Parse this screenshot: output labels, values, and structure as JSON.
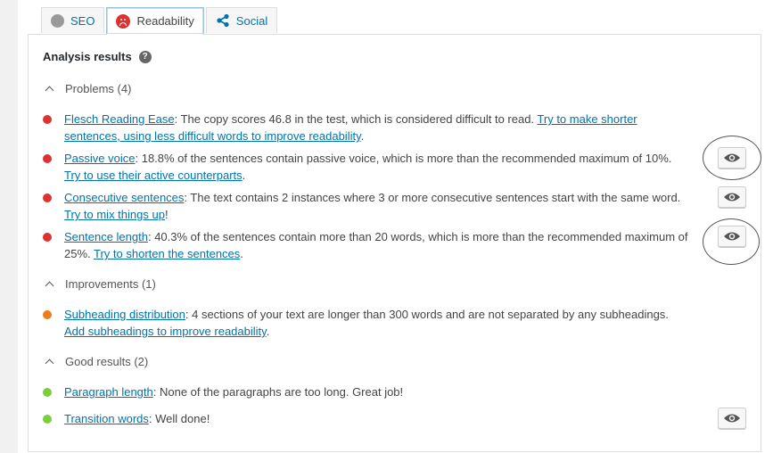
{
  "tabs": [
    {
      "label": "SEO",
      "icon": "neutral-dot-icon"
    },
    {
      "label": "Readability",
      "icon": "sad-face-icon"
    },
    {
      "label": "Social",
      "icon": "share-icon"
    }
  ],
  "colors": {
    "problem": "#dc3232",
    "improvement": "#ee7c1b",
    "good": "#7ad03a",
    "link": "#0073aa"
  },
  "analysis": {
    "title": "Analysis results",
    "sections": {
      "problems": {
        "label": "Problems (4)",
        "items": [
          {
            "link": "Flesch Reading Ease",
            "text": ": The copy scores 46.8 in the test, which is considered difficult to read. ",
            "action": "Try to make shorter sentences, using less difficult words to improve readability",
            "tail": "."
          },
          {
            "link": "Passive voice",
            "text": ": 18.8% of the sentences contain passive voice, which is more than the recommended maximum of 10%. ",
            "action": "Try to use their active counterparts",
            "tail": "."
          },
          {
            "link": "Consecutive sentences",
            "text": ": The text contains 2 instances where 3 or more consecutive sentences start with the same word. ",
            "action": "Try to mix things up",
            "tail": "!"
          },
          {
            "link": "Sentence length",
            "text": ": 40.3% of the sentences contain more than 20 words, which is more than the recommended maximum of 25%. ",
            "action": "Try to shorten the sentences",
            "tail": "."
          }
        ]
      },
      "improvements": {
        "label": "Improvements (1)",
        "items": [
          {
            "link": "Subheading distribution",
            "text": ": 4 sections of your text are longer than 300 words and are not separated by any subheadings. ",
            "action": "Add subheadings to improve readability",
            "tail": "."
          }
        ]
      },
      "good": {
        "label": "Good results (2)",
        "items": [
          {
            "link": "Paragraph length",
            "text": ": None of the paragraphs are too long. Great job!"
          },
          {
            "link": "Transition words",
            "text": ": Well done!"
          }
        ]
      }
    }
  }
}
